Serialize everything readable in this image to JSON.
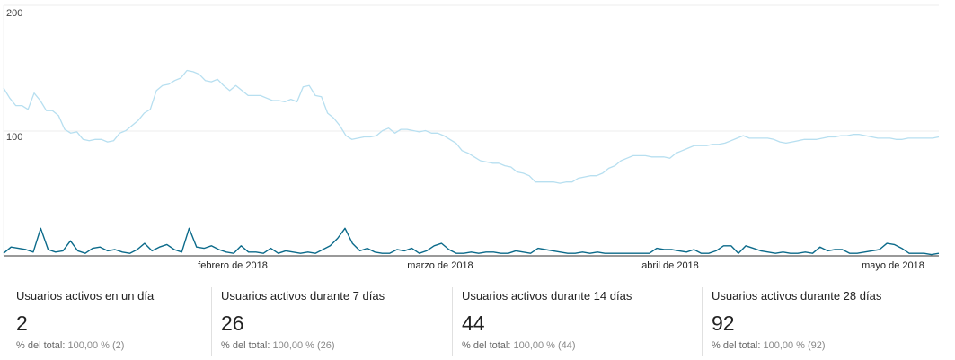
{
  "chart_data": {
    "type": "line",
    "title": "",
    "ylim": [
      0,
      200
    ],
    "y_ticks": [
      "200",
      "100"
    ],
    "x_tick_labels": [
      "febrero de 2018",
      "marzo de 2018",
      "abril de 2018",
      "mayo de 2018"
    ],
    "grid": true,
    "series": [
      {
        "color": "#b7dff0",
        "values": [
          134,
          126,
          120,
          120,
          117,
          130,
          124,
          116,
          116,
          112,
          101,
          98,
          99,
          93,
          92,
          93,
          93,
          91,
          92,
          98,
          100,
          104,
          108,
          114,
          117,
          132,
          136,
          137,
          140,
          142,
          148,
          147,
          145,
          140,
          139,
          141,
          136,
          132,
          136,
          132,
          128,
          128,
          128,
          126,
          124,
          124,
          123,
          125,
          123,
          135,
          136,
          128,
          127,
          114,
          110,
          104,
          96,
          93,
          94,
          95,
          95,
          96,
          100,
          102,
          98,
          101,
          101,
          100,
          99,
          100,
          98,
          98,
          96,
          93,
          90,
          84,
          82,
          79,
          76,
          75,
          74,
          74,
          72,
          71,
          67,
          66,
          64,
          59,
          59,
          59,
          59,
          58,
          59,
          59,
          62,
          63,
          64,
          64,
          66,
          70,
          72,
          76,
          78,
          80,
          80,
          80,
          79,
          79,
          79,
          78,
          82,
          84,
          86,
          88,
          88,
          88,
          89,
          89,
          90,
          92,
          94,
          96,
          94,
          94,
          94,
          94,
          93,
          91,
          90,
          91,
          92,
          93,
          93,
          93,
          94,
          95,
          95,
          96,
          96,
          97,
          97,
          96,
          95,
          94,
          94,
          94,
          93,
          93,
          94,
          94,
          94,
          94,
          94,
          95
        ]
      },
      {
        "color": "#0b6a8a",
        "values": [
          2,
          7,
          6,
          5,
          3,
          22,
          5,
          3,
          4,
          12,
          4,
          2,
          6,
          7,
          4,
          5,
          3,
          2,
          5,
          10,
          4,
          7,
          9,
          5,
          3,
          22,
          7,
          6,
          8,
          5,
          3,
          2,
          8,
          3,
          3,
          2,
          6,
          2,
          4,
          3,
          2,
          3,
          2,
          5,
          8,
          14,
          22,
          10,
          4,
          6,
          3,
          2,
          2,
          5,
          4,
          6,
          2,
          4,
          8,
          10,
          5,
          2,
          2,
          3,
          2,
          3,
          3,
          2,
          2,
          4,
          3,
          2,
          6,
          5,
          4,
          3,
          2,
          2,
          3,
          2,
          3,
          2,
          2,
          2,
          2,
          2,
          2,
          2,
          6,
          5,
          5,
          4,
          3,
          5,
          2,
          2,
          4,
          8,
          8,
          2,
          8,
          6,
          4,
          3,
          2,
          3,
          2,
          2,
          3,
          2,
          7,
          4,
          5,
          5,
          2,
          2,
          3,
          4,
          5,
          10,
          9,
          6,
          2,
          2,
          2,
          1,
          2
        ]
      }
    ]
  },
  "scorecards": [
    {
      "title": "Usuarios activos en un día",
      "value": "2",
      "sub_label": "% del total:",
      "sub_pct": "100,00 % (2)"
    },
    {
      "title": "Usuarios activos durante 7 días",
      "value": "26",
      "sub_label": "% del total:",
      "sub_pct": "100,00 % (26)"
    },
    {
      "title": "Usuarios activos durante 14 días",
      "value": "44",
      "sub_label": "% del total:",
      "sub_pct": "100,00 % (44)"
    },
    {
      "title": "Usuarios activos durante 28 días",
      "value": "92",
      "sub_label": "% del total:",
      "sub_pct": "100,00 % (92)"
    }
  ]
}
